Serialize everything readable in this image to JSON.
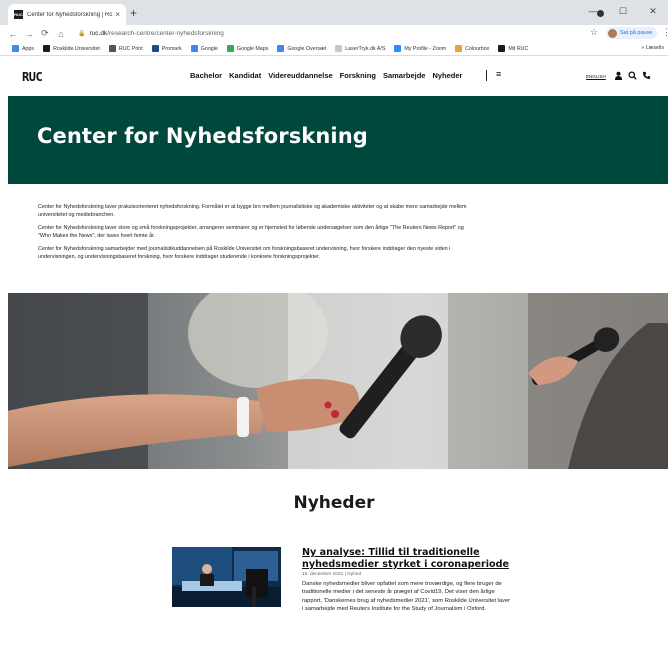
{
  "browser": {
    "tab_favicon": "RUC",
    "tab_title": "Center for Nyhedsforskning | Ros",
    "tab_close": "×",
    "new_tab": "+",
    "url_host": "ruc.dk",
    "url_path": "/research-centre/center-nyhedsforskning",
    "pause_label": "Sat på pause",
    "bookmarks": [
      {
        "label": "Apps",
        "icon": "apps-grid-icon",
        "color": "#4285f4"
      },
      {
        "label": "Roskilde Universitet",
        "icon": "ruc-icon",
        "color": "#1c1c1c"
      },
      {
        "label": "RUC Print",
        "icon": "globe-icon",
        "color": "#555555"
      },
      {
        "label": "Promark",
        "icon": "promark-icon",
        "color": "#1e4a8c"
      },
      {
        "label": "Google",
        "icon": "google-icon",
        "color": "#4285f4"
      },
      {
        "label": "Google Maps",
        "icon": "maps-pin-icon",
        "color": "#34a853"
      },
      {
        "label": "Google Oversæt",
        "icon": "translate-icon",
        "color": "#4285f4"
      },
      {
        "label": "LaserTryk.dk A/S",
        "icon": "lasertryk-icon",
        "color": "#c8c8c8"
      },
      {
        "label": "My Profile - Zoom",
        "icon": "zoom-icon",
        "color": "#2d8cff"
      },
      {
        "label": "Colourbox",
        "icon": "colourbox-icon",
        "color": "#e8a33d"
      },
      {
        "label": "Mit RUC",
        "icon": "ruc-icon",
        "color": "#1c1c1c"
      }
    ],
    "bookmarks_more": "»",
    "reading_list": "Læselis"
  },
  "site": {
    "logo": "RUC",
    "nav": [
      "Bachelor",
      "Kandidat",
      "Videreuddannelse",
      "Forskning",
      "Samarbejde",
      "Nyheder"
    ],
    "lang": "ENGLISH",
    "accent_color": "#00473c"
  },
  "hero": {
    "title": "Center for Nyhedsforskning"
  },
  "intro": {
    "p1": "Center for Nyhedsforskning laver praksisorienteret nyhedsforskning. Formålet er at bygge bro mellem journalistiske og akademiske aktiviteter og at skabe mere samarbejde mellem universitetet og mediebranchen.",
    "p2": "Center for Nyhedsforskning laver store og små forskningsprojekter, arrangerer seminarer og er hjemsted for løbende undersøgelser som den årlige \"The Reuters News Report\" og \"Who Makes the News\", der laves hvert femte år.",
    "p3": "Center for Nyhedsforskning samarbejder med journalistikuddannelsen på Roskilde Universitet om forskningsbaseret undervisning, hvor forskere inddrager den nyeste viden i undervisningen, og undervisningsbaseret forskning, hvor forskere inddrager studerende i konkrete forskningsprojekter."
  },
  "news": {
    "title": "Nyheder",
    "items": [
      {
        "headline": "Ny analyse: Tillid til traditionelle nyhedsmedier styrket i coronaperiode",
        "meta": "15. december 2021  |  Nyhed",
        "excerpt": "Danske nyhedsmedier bliver opfattet som mere troværdige, og flere bruger de traditionelle medier i det seneste år præget af Covid19. Det viser den årlige rapport, 'Danskernes brug af nyhedsmedier 2021', som Roskilde Universitet laver i samarbejde med Reuters Institute for the Study of Journalism i Oxford."
      }
    ]
  }
}
